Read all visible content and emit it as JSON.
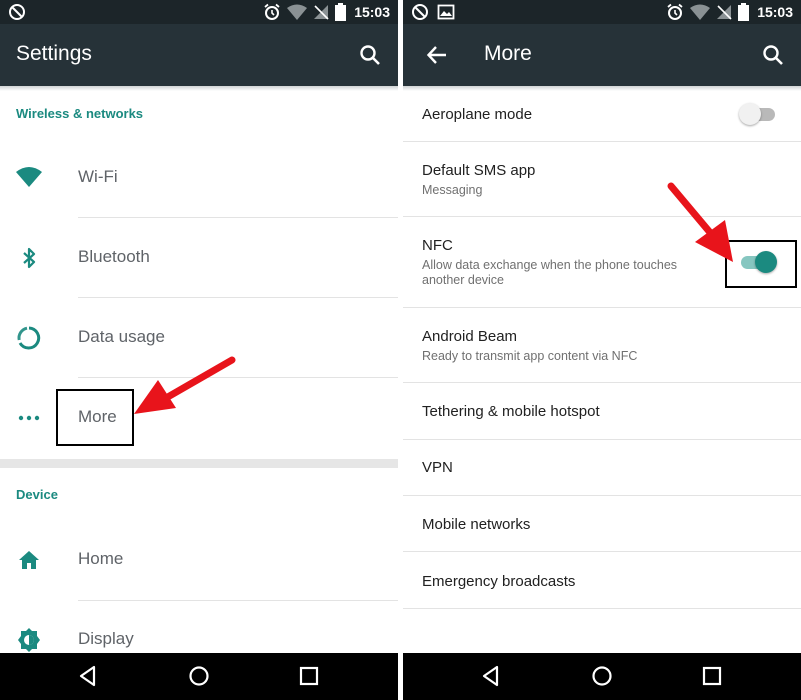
{
  "status_bar": {
    "time": "15:03"
  },
  "left_screen": {
    "title": "Settings",
    "sections": [
      {
        "header": "Wireless & networks",
        "items": [
          {
            "label": "Wi-Fi",
            "icon": "wifi-icon"
          },
          {
            "label": "Bluetooth",
            "icon": "bluetooth-icon"
          },
          {
            "label": "Data usage",
            "icon": "data-usage-icon"
          },
          {
            "label": "More",
            "icon": "more-dots-icon"
          }
        ]
      },
      {
        "header": "Device",
        "items": [
          {
            "label": "Home",
            "icon": "home-icon"
          },
          {
            "label": "Display",
            "icon": "display-brightness-icon"
          }
        ]
      }
    ]
  },
  "right_screen": {
    "title": "More",
    "items": [
      {
        "title": "Aeroplane mode",
        "subtitle": "",
        "toggle": "off"
      },
      {
        "title": "Default SMS app",
        "subtitle": "Messaging"
      },
      {
        "title": "NFC",
        "subtitle": "Allow data exchange when the phone touches another device",
        "toggle": "on"
      },
      {
        "title": "Android Beam",
        "subtitle": "Ready to transmit app content via NFC"
      },
      {
        "title": "Tethering & mobile hotspot",
        "subtitle": ""
      },
      {
        "title": "VPN",
        "subtitle": ""
      },
      {
        "title": "Mobile networks",
        "subtitle": ""
      },
      {
        "title": "Emergency broadcasts",
        "subtitle": ""
      }
    ]
  },
  "colors": {
    "appbar": "#263238",
    "statusbar": "#1c2529",
    "accent": "#1b8a80",
    "annotation_arrow": "#e8141b"
  }
}
